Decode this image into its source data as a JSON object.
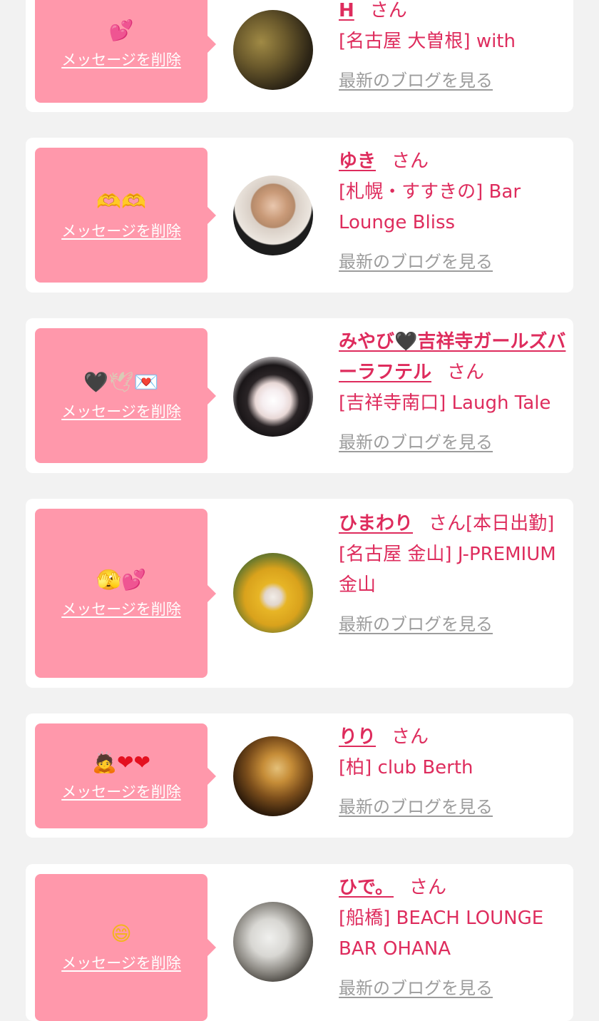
{
  "messages": [
    {
      "emoji": "💕",
      "delete_label": "メッセージを削除",
      "name": "H",
      "honorific": "さん",
      "status": "",
      "shop": "[名古屋 大曽根] with",
      "blog_link": "最新のブログを見る"
    },
    {
      "emoji": "🫶🫶",
      "delete_label": "メッセージを削除",
      "name": "ゆき",
      "honorific": "さん",
      "status": "",
      "shop": "[札幌・すすきの] Bar Lounge Bliss",
      "blog_link": "最新のブログを見る"
    },
    {
      "emoji": "🖤🕊💌",
      "delete_label": "メッセージを削除",
      "name": "みやび🖤吉祥寺ガールズバーラフテル",
      "honorific": "さん",
      "status": "",
      "shop": "[吉祥寺南口] Laugh Tale",
      "blog_link": "最新のブログを見る"
    },
    {
      "emoji": "🫣💕",
      "delete_label": "メッセージを削除",
      "name": "ひまわり",
      "honorific": "さん",
      "status": "[本日出勤]",
      "shop": "[名古屋 金山] J-PREMIUM 金山",
      "blog_link": "最新のブログを見る"
    },
    {
      "emoji": "🙇❤️❤️",
      "delete_label": "メッセージを削除",
      "name": "りり",
      "honorific": "さん",
      "status": "",
      "shop": "[柏] club Berth",
      "blog_link": "最新のブログを見る"
    },
    {
      "emoji": "😄",
      "delete_label": "メッセージを削除",
      "name": "ひで。",
      "honorific": "さん",
      "status": "",
      "shop": "[船橋] BEACH LOUNGE BAR OHANA",
      "blog_link": "最新のブログを見る"
    }
  ]
}
